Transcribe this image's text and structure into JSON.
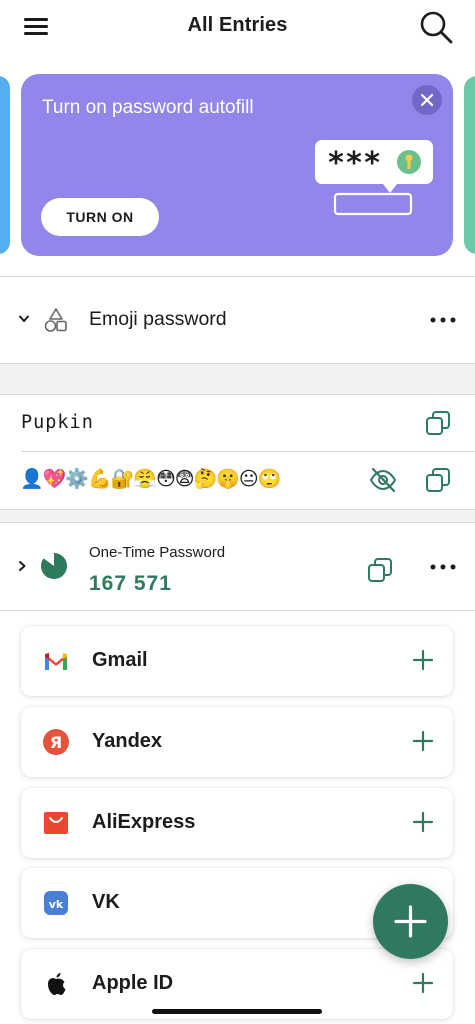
{
  "header": {
    "title": "All Entries",
    "menu_icon": "hamburger-menu-icon",
    "search_icon": "search-icon"
  },
  "banner": {
    "title": "Turn on password autofill",
    "button_label": "TURN ON",
    "close_icon": "close-icon",
    "illustration_text": "***",
    "background_color": "#9186ea"
  },
  "folder": {
    "label": "Emoji password",
    "icon": "shapes-icon",
    "expand_icon": "chevron-down-icon",
    "more_icon": "more-dots-icon"
  },
  "fields": {
    "username": "Pupkin",
    "password": "👤💖⚙️💪🔐😤😳😨🤔🤫😐🙄",
    "visibility_icon": "eye-off-icon",
    "copy_icon": "copy-icon"
  },
  "otp": {
    "label": "One-Time Password",
    "code": "167 571",
    "accent_color": "#2d7a5d"
  },
  "services": [
    {
      "name": "Gmail",
      "icon": "gmail-logo"
    },
    {
      "name": "Yandex",
      "icon": "yandex-logo"
    },
    {
      "name": "AliExpress",
      "icon": "aliexpress-logo"
    },
    {
      "name": "VK",
      "icon": "vk-logo"
    },
    {
      "name": "Apple ID",
      "icon": "apple-logo"
    }
  ],
  "fab": {
    "icon": "plus-icon",
    "color": "#2f7a5f"
  }
}
